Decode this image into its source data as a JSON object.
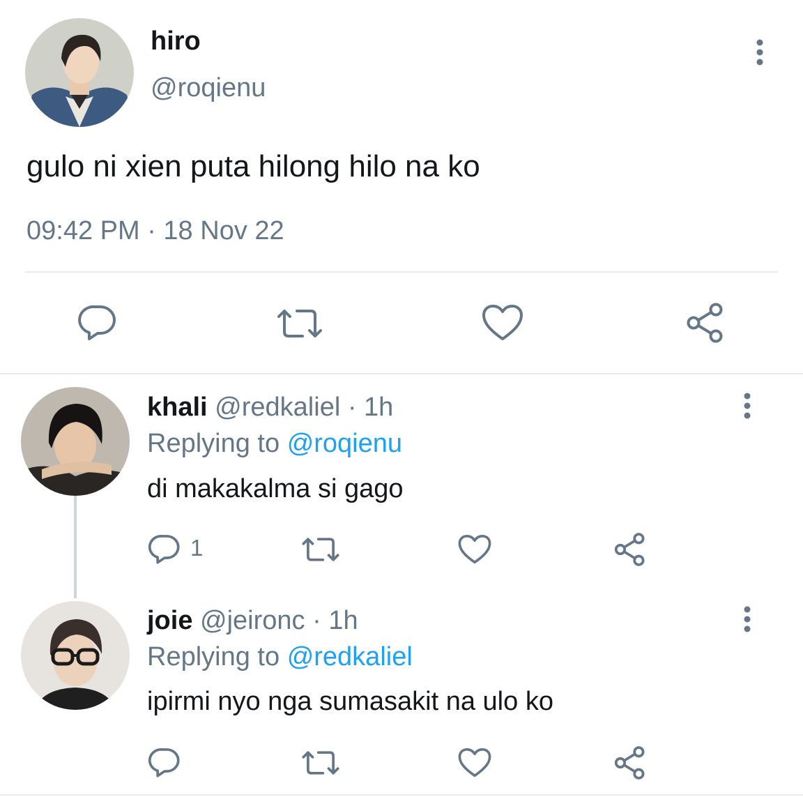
{
  "main_tweet": {
    "display_name": "hiro",
    "handle": "@roqienu",
    "text": "gulo ni xien puta hilong hilo na ko",
    "timestamp": "09:42 PM · 18 Nov 22",
    "actions": [
      "reply-icon",
      "retweet-icon",
      "like-icon",
      "share-icon"
    ]
  },
  "replies": [
    {
      "display_name": "khali",
      "handle": "@redkaliel",
      "time": "· 1h",
      "replying_label": "Replying to",
      "replying_to": "@roqienu",
      "text": "di makakalma si gago",
      "reply_count": "1"
    },
    {
      "display_name": "joie",
      "handle": "@jeironc",
      "time": "· 1h",
      "replying_label": "Replying to",
      "replying_to": "@redkaliel",
      "text": "ipirmi nyo nga sumasakit na ulo ko",
      "reply_count": ""
    }
  ],
  "colors": {
    "text": "#14171a",
    "muted": "#657786",
    "link": "#1da1f2",
    "divider": "#e6ecf0",
    "background": "#ffffff"
  }
}
